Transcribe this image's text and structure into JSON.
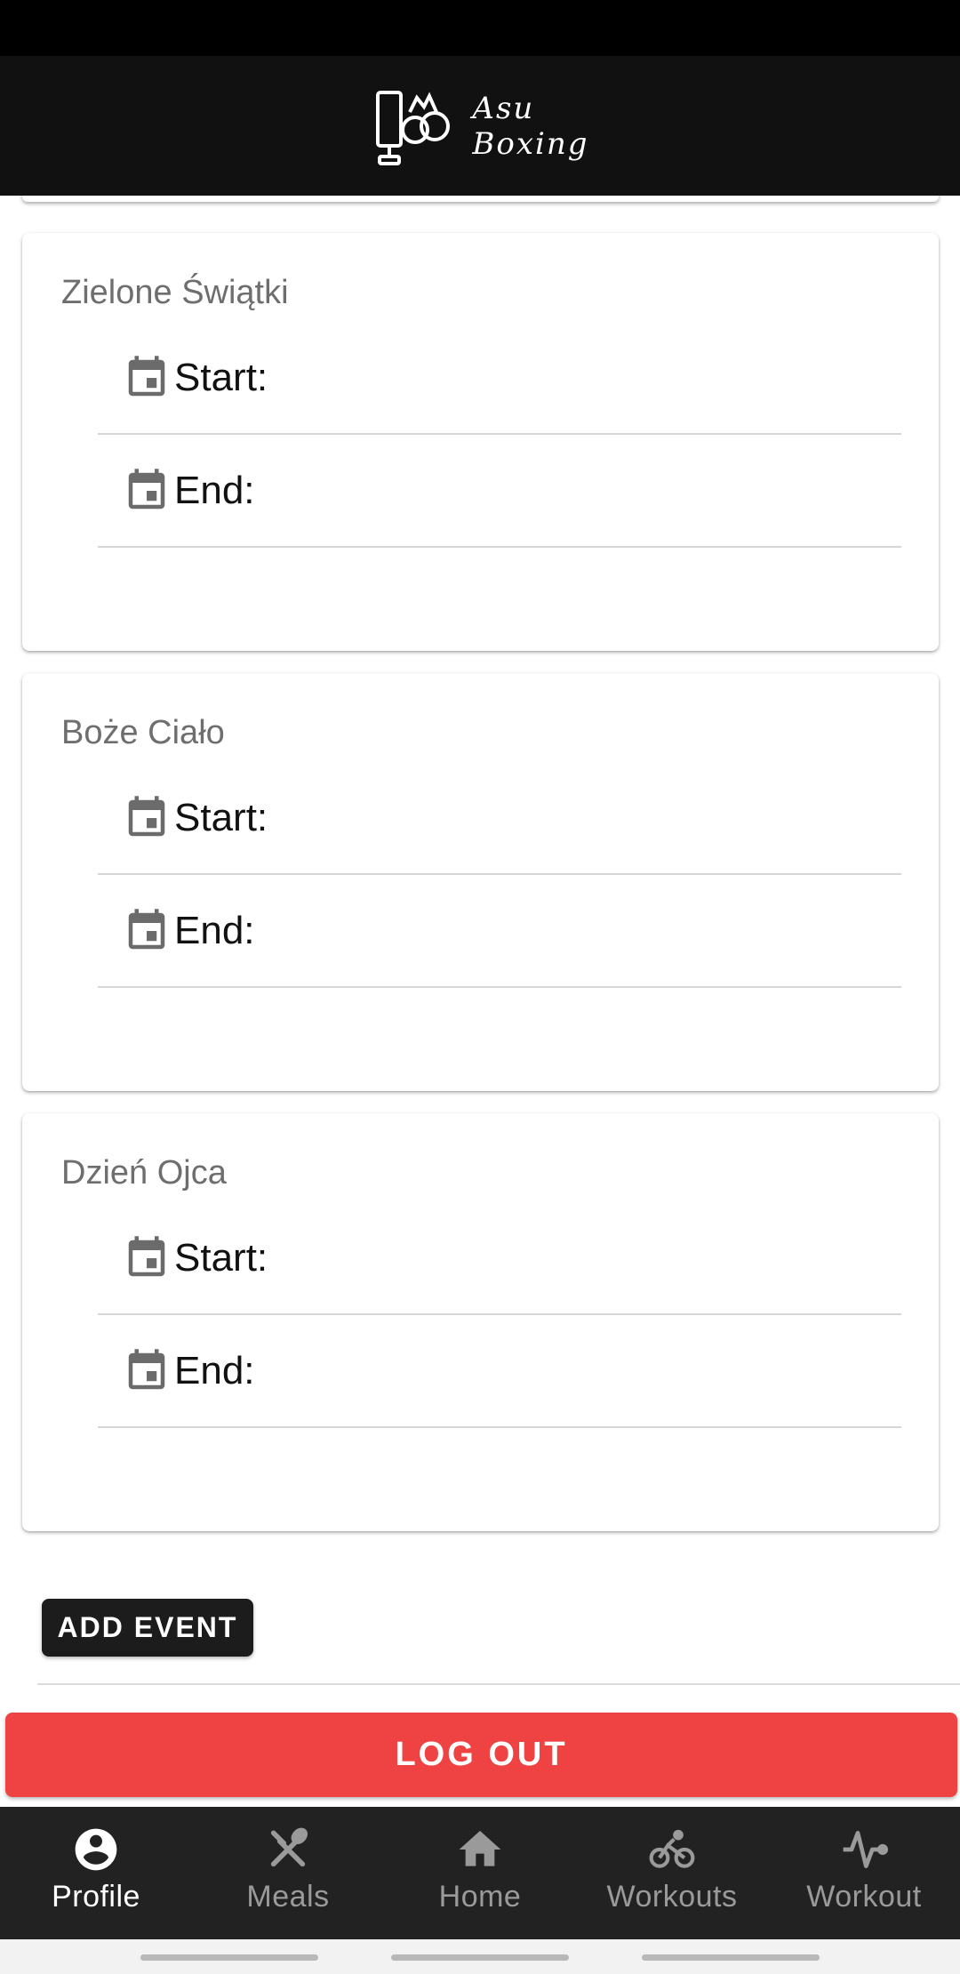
{
  "header": {
    "logo_line1": "Asu",
    "logo_line2": "Boxing"
  },
  "events": [
    {
      "title": "Zielone Świątki",
      "start_label": "Start:",
      "end_label": "End:"
    },
    {
      "title": "Boże Ciało",
      "start_label": "Start:",
      "end_label": "End:"
    },
    {
      "title": "Dzień Ojca",
      "start_label": "Start:",
      "end_label": "End:"
    }
  ],
  "add_event_label": "ADD EVENT",
  "logout_label": "LOG OUT",
  "nav": [
    {
      "label": "Profile",
      "icon": "profile-icon",
      "active": true
    },
    {
      "label": "Meals",
      "icon": "meals-icon",
      "active": false
    },
    {
      "label": "Home",
      "icon": "home-icon",
      "active": false
    },
    {
      "label": "Workouts",
      "icon": "bike-icon",
      "active": false
    },
    {
      "label": "Workout",
      "icon": "activity-icon",
      "active": false
    }
  ],
  "colors": {
    "header": "#111111",
    "logout": "#ef4343",
    "nav_bg": "#222222",
    "button_dark": "#1c1c1c"
  }
}
